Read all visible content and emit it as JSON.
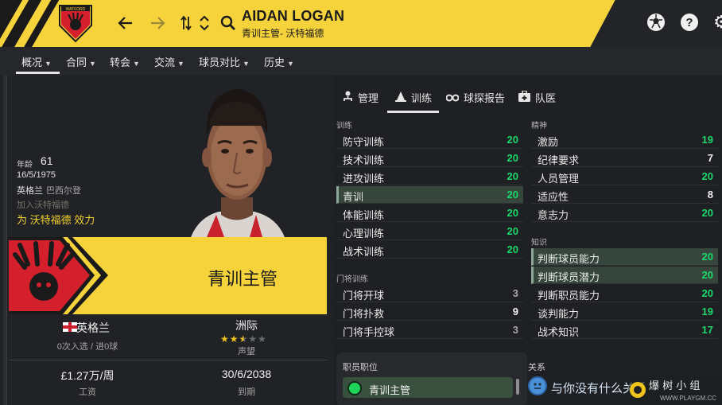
{
  "header": {
    "club_badge_text": "WATFORD",
    "name": "AIDAN LOGAN",
    "subtitle": "青训主管- 沃特福德",
    "icons": [
      "back-arrow-icon",
      "forward-arrow-icon",
      "swap-icon",
      "up-down-chevron-icon",
      "search-icon",
      "ball-icon",
      "help-icon",
      "gear-icon"
    ]
  },
  "tabs": [
    {
      "label": "概况"
    },
    {
      "label": "合同"
    },
    {
      "label": "转会"
    },
    {
      "label": "交流"
    },
    {
      "label": "球员对比"
    },
    {
      "label": "历史"
    }
  ],
  "profile": {
    "age_label": "年龄",
    "age": "61",
    "dob": "16/5/1975",
    "nationality": "英格兰",
    "second_nationality": "巴西尔登",
    "ghost_text": "加入沃特福德",
    "plays_for": "为 沃特福德 效力",
    "role": "青训主管"
  },
  "info": {
    "nation": "英格兰",
    "caps": "0次入选 / 进0球",
    "continent": "洲际",
    "reputation_label": "声望",
    "reputation_stars": 2.5,
    "reputation_max": 5,
    "wage": "£1.27万/周",
    "wage_label": "工资",
    "expiry": "30/6/2038",
    "expiry_label": "到期"
  },
  "subtabs": [
    {
      "label": "管理",
      "icon": "person-tree-icon"
    },
    {
      "label": "训练",
      "icon": "cone-icon"
    },
    {
      "label": "球探报告",
      "icon": "binoculars-icon"
    },
    {
      "label": "队医",
      "icon": "medical-kit-icon"
    }
  ],
  "coaching": {
    "label": "训练",
    "rows": [
      {
        "name": "防守训练",
        "value": "20"
      },
      {
        "name": "技术训练",
        "value": "20"
      },
      {
        "name": "进攻训练",
        "value": "20"
      },
      {
        "name": "青训",
        "value": "20"
      },
      {
        "name": "体能训练",
        "value": "20"
      },
      {
        "name": "心理训练",
        "value": "20"
      },
      {
        "name": "战术训练",
        "value": "20"
      }
    ]
  },
  "goalkeeping": {
    "label": "门将训练",
    "rows": [
      {
        "name": "门将开球",
        "value": "3"
      },
      {
        "name": "门将扑救",
        "value": "9"
      },
      {
        "name": "门将手控球",
        "value": "3"
      }
    ]
  },
  "mental": {
    "label": "精神",
    "rows": [
      {
        "name": "激励",
        "value": "19"
      },
      {
        "name": "纪律要求",
        "value": "7"
      },
      {
        "name": "人员管理",
        "value": "20"
      },
      {
        "name": "适应性",
        "value": "8"
      },
      {
        "name": "意志力",
        "value": "20"
      }
    ]
  },
  "knowledge": {
    "label": "知识",
    "rows": [
      {
        "name": "判断球员能力",
        "value": "20"
      },
      {
        "name": "判断球员潜力",
        "value": "20"
      },
      {
        "name": "判断职员能力",
        "value": "20"
      },
      {
        "name": "谈判能力",
        "value": "19"
      },
      {
        "name": "战术知识",
        "value": "17"
      }
    ]
  },
  "position": {
    "label": "职员职位",
    "value": "青训主管"
  },
  "relations": {
    "label": "关系",
    "text": "与你没有什么关系"
  },
  "watermark": {
    "text": "爆 树 小 组",
    "url": "WWW.PLAYGM.CC"
  },
  "colors": {
    "accent_yellow": "#f6d23b",
    "value_green": "#19d96a",
    "badge_red": "#d4202c"
  }
}
